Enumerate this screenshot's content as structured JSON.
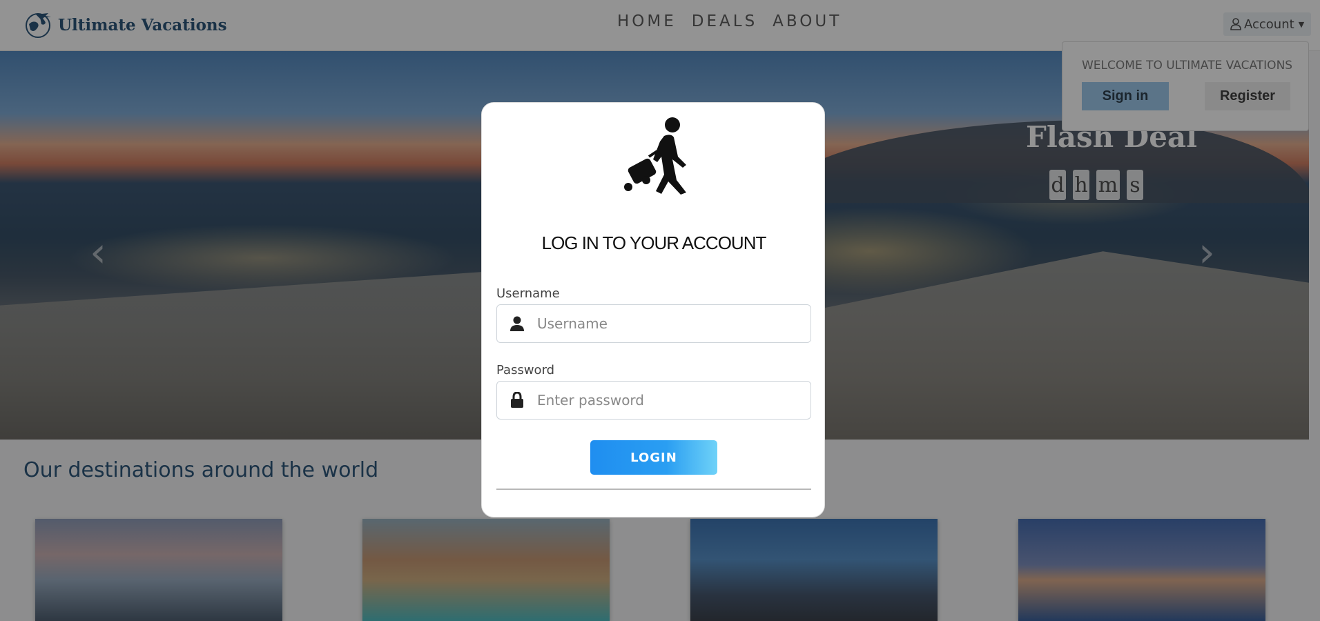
{
  "navbar": {
    "brand": "Ultimate Vacations",
    "links": [
      "HOME",
      "DEALS",
      "ABOUT"
    ],
    "account_label": "Account"
  },
  "dropdown": {
    "header": "WELCOME TO ULTIMATE VACATIONS",
    "signin": "Sign in",
    "register": "Register"
  },
  "hero": {
    "flash_title": "Flash Deal",
    "countdown": [
      "d",
      "h",
      "m",
      "s"
    ]
  },
  "main": {
    "section_title": "Our destinations around the world"
  },
  "login_modal": {
    "title": "LOG IN TO YOUR ACCOUNT",
    "username_label": "Username",
    "username_placeholder": "Username",
    "password_label": "Password",
    "password_placeholder": "Enter password",
    "submit": "LOGIN"
  },
  "icons": {
    "brand": "globe-plane-icon",
    "account": "user-outline-icon",
    "modal": "traveler-with-suitcase-icon",
    "username": "user-icon",
    "password": "lock-icon"
  },
  "colors": {
    "brand": "#0d3d66",
    "login_gradient_start": "#1f8ef0",
    "login_gradient_end": "#6fd2f8",
    "signin_bg": "#8fc1e8"
  }
}
